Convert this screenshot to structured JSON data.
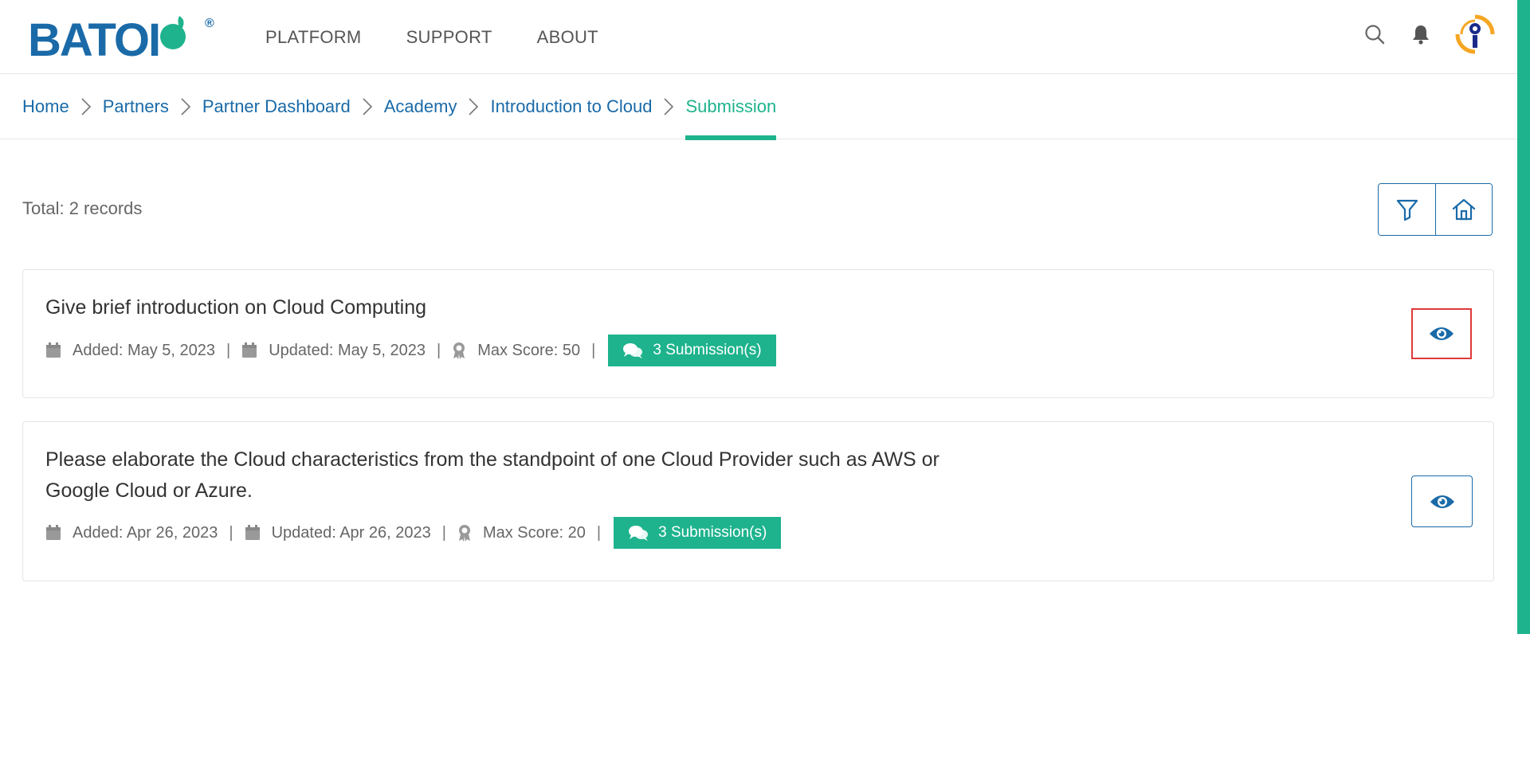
{
  "header": {
    "logo_text": "BATOI",
    "nav": [
      "PLATFORM",
      "SUPPORT",
      "ABOUT"
    ]
  },
  "breadcrumb": [
    "Home",
    "Partners",
    "Partner Dashboard",
    "Academy",
    "Introduction to Cloud",
    "Submission"
  ],
  "toolbar": {
    "total": "Total: 2 records"
  },
  "records": [
    {
      "title": "Give brief introduction on Cloud Computing",
      "added": "Added: May 5, 2023",
      "updated": "Updated: May 5, 2023",
      "max_score": "Max Score: 50",
      "submissions": "3 Submission(s)"
    },
    {
      "title": "Please elaborate the Cloud characteristics from the standpoint of one Cloud Provider such as AWS or Google Cloud or Azure.",
      "added": "Added: Apr 26, 2023",
      "updated": "Updated: Apr 26, 2023",
      "max_score": "Max Score: 20",
      "submissions": "3 Submission(s)"
    }
  ],
  "colors": {
    "brand_blue": "#1a6aa8",
    "accent_green": "#1eb38d",
    "highlight_red": "#e03a3a"
  },
  "icons": [
    "search-icon",
    "bell-icon",
    "filter-icon",
    "home-icon",
    "calendar-icon",
    "award-icon",
    "comments-icon",
    "eye-icon",
    "chevron-right-icon"
  ]
}
